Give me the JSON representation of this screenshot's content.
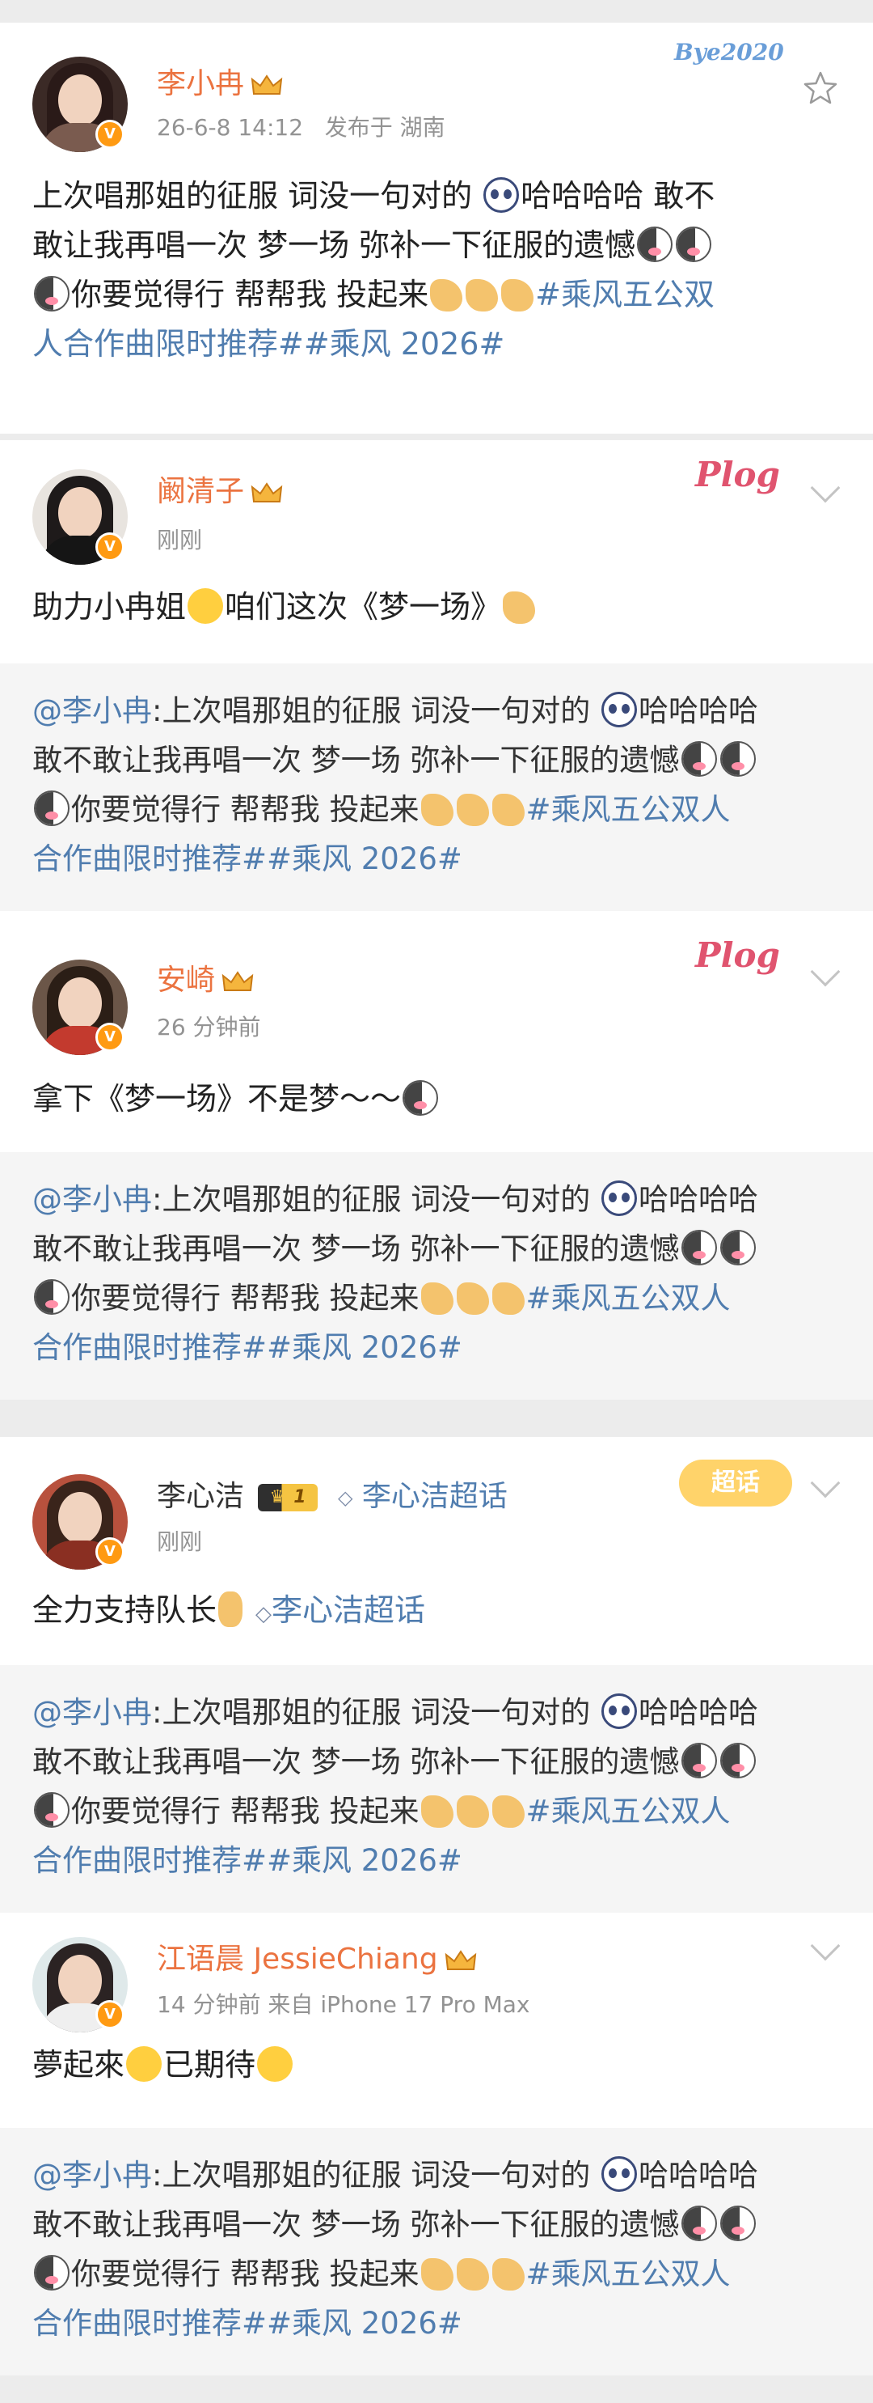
{
  "post": {
    "author": "李小冉",
    "time": "26-6-8 14:12",
    "location": "发布于 湖南",
    "sticker": "Bye2020",
    "text_1": "上次唱那姐的征服 词没一句对的",
    "text_2": "哈哈哈哈 敢不",
    "text_3": "敢让我再唱一次 梦一场 弥补一下征服的遗憾",
    "text_4": "你要觉得行 帮帮我 投起来",
    "hashtag_1": "#乘风五公双",
    "hashtag_2": "人合作曲限时推荐##乘风 2026#"
  },
  "quote": {
    "prefix": "@李小冉",
    "line_1": ":上次唱那姐的征服 词没一句对的",
    "line_1b": "哈哈哈哈",
    "line_2": "敢不敢让我再唱一次 梦一场 弥补一下征服的遗憾",
    "line_3": "你要觉得行 帮帮我 投起来",
    "line_3_tag": "#乘风五公双人",
    "line_4": "合作曲限时推荐##乘风 2026#"
  },
  "comments": [
    {
      "name": "阚清子",
      "meta": "刚刚",
      "text_a": "助力小冉姐",
      "text_b": "咱们这次《梦一场》",
      "sticker": "Plog"
    },
    {
      "name": "安崎",
      "meta": "26 分钟前",
      "text_a": "拿下《梦一场》不是梦～～",
      "sticker": "Plog"
    },
    {
      "name": "李心洁",
      "meta": "刚刚",
      "level": "1",
      "supertopic": "李心洁超话",
      "text_a": "全力支持队长",
      "text_b": "李心洁超话",
      "sticker": "超话"
    },
    {
      "name": "江语晨 JessieChiang",
      "meta": "14 分钟前  来自 iPhone 17 Pro Max",
      "text_a": "夢起來",
      "text_b": "已期待"
    }
  ],
  "colors": {
    "orange_name": "#eb7340",
    "link": "#507daf",
    "vip_badge": "#ff9a12",
    "quote_bg": "#f5f5f5"
  }
}
